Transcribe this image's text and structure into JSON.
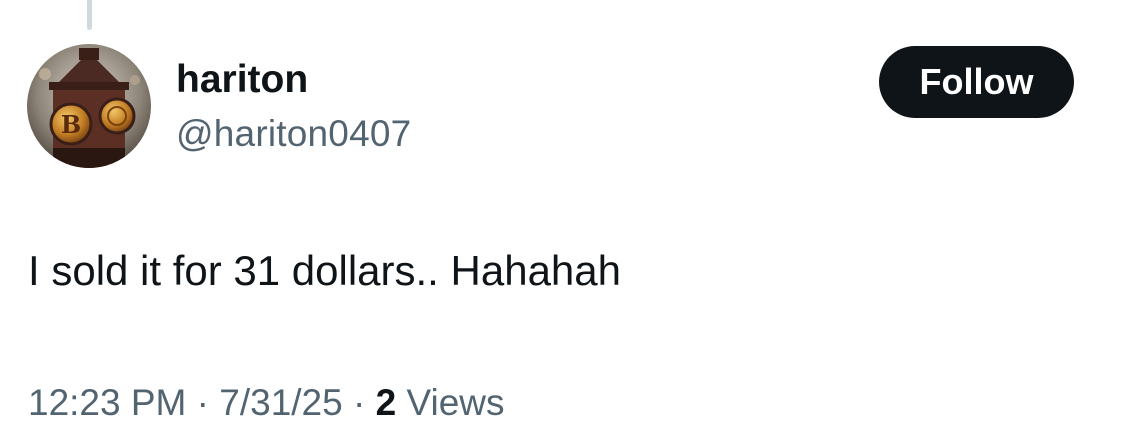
{
  "tweet": {
    "author": {
      "display_name": "hariton",
      "handle": "@hariton0407",
      "avatar": "bitcoin-clocktower-avatar"
    },
    "follow_label": "Follow",
    "text": "I sold it for 31 dollars.. Hahahah",
    "meta": {
      "time": "12:23 PM",
      "separator": "·",
      "date": "7/31/25",
      "views_count": "2",
      "views_label": "Views"
    }
  },
  "colors": {
    "text_primary": "#0f1419",
    "text_secondary": "#536471",
    "button_bg": "#0f1419",
    "button_text": "#ffffff",
    "thread_line": "#cfd9de"
  }
}
